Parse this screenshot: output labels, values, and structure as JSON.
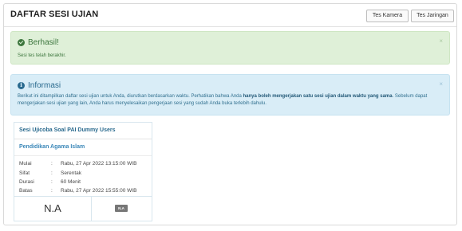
{
  "header": {
    "title": "DAFTAR SESI UJIAN",
    "buttons": {
      "camera": "Tes Kamera",
      "network": "Tes Jaringan"
    }
  },
  "alerts": {
    "success": {
      "title": "Berhasil!",
      "message": "Sesi tes telah berakhir.",
      "close": "×"
    },
    "info": {
      "title": "Informasi",
      "message_part1": "Berikut ini ditampilkan daftar sesi ujian untuk Anda, diurutkan berdasarkan waktu. Perhatikan bahwa Anda ",
      "message_bold": "hanya boleh mengerjakan satu sesi ujian dalam waktu yang sama",
      "message_part2": ". Sebelum dapat mengerjakan sesi ujian yang lain, Anda harus menyelesaikan pengerjaan sesi yang sudah Anda buka terlebih dahulu.",
      "close": "×"
    }
  },
  "session_card": {
    "name": "Sesi Ujicoba Soal PAI Dummy Users",
    "subject": "Pendidikan Agama Islam",
    "details": [
      {
        "label": "Mulai",
        "value": "Rabu, 27 Apr 2022 13:15:00 WIB"
      },
      {
        "label": "Sifat",
        "value": "Serentak"
      },
      {
        "label": "Durasi",
        "value": "60 Menit"
      },
      {
        "label": "Batas",
        "value": "Rabu, 27 Apr 2022 15:55:00 WIB"
      }
    ],
    "separator": ":",
    "score": "N.A",
    "grade_badge": "N.A"
  }
}
